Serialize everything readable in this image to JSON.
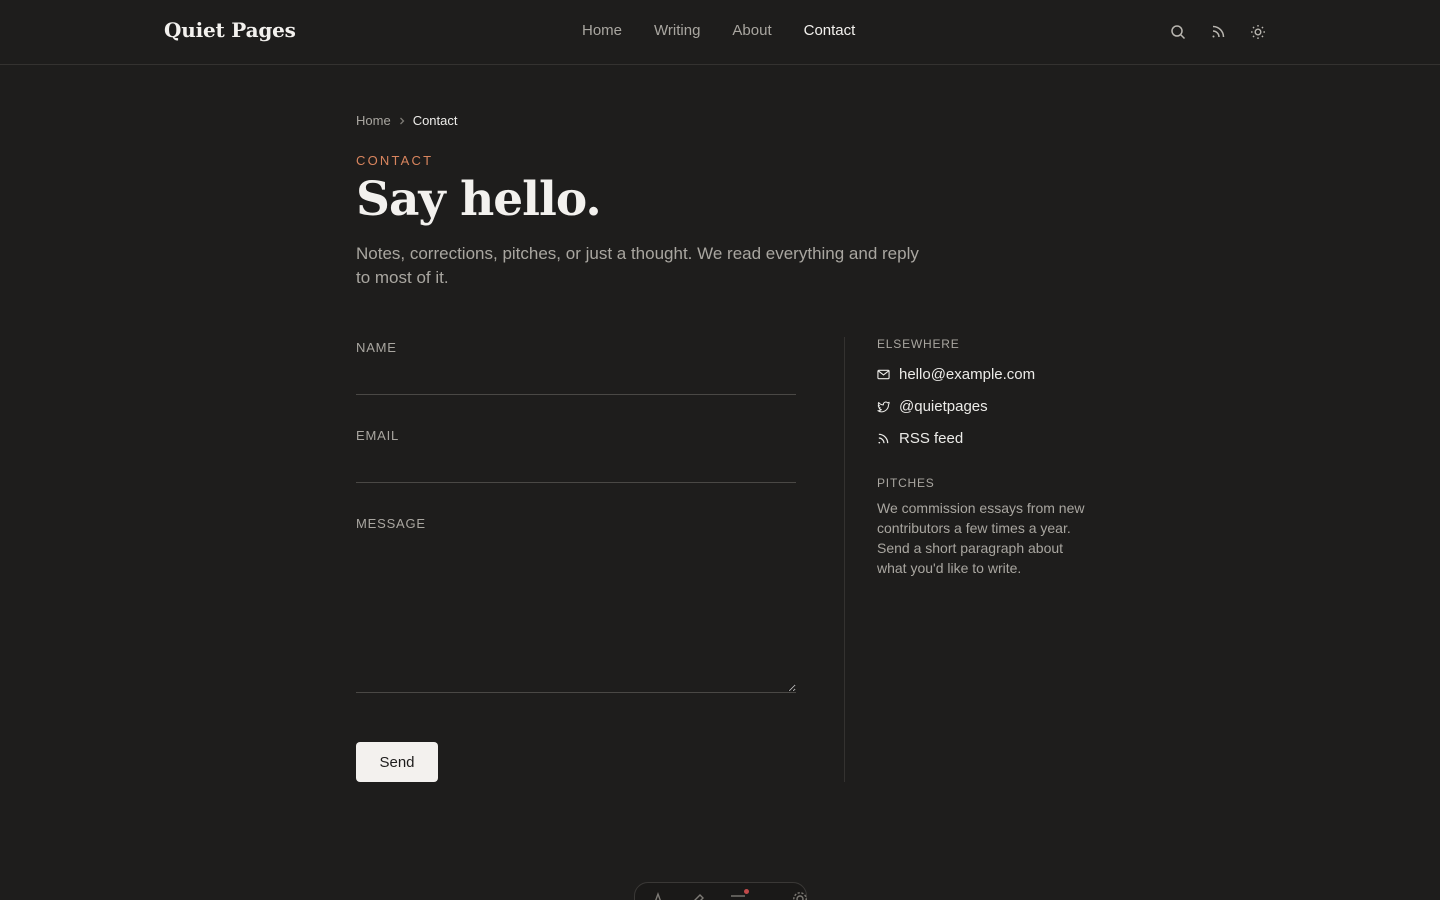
{
  "header": {
    "brand": "Quiet Pages",
    "nav": [
      {
        "label": "Home",
        "active": false
      },
      {
        "label": "Writing",
        "active": false
      },
      {
        "label": "About",
        "active": false
      },
      {
        "label": "Contact",
        "active": true
      }
    ],
    "icons": [
      "search-icon",
      "rss-icon",
      "sun-icon"
    ]
  },
  "breadcrumb": {
    "home": "Home",
    "current": "Contact"
  },
  "hero": {
    "eyebrow": "CONTACT",
    "title": "Say hello.",
    "intro": "Notes, corrections, pitches, or just a thought. We read everything and reply to most of it."
  },
  "form": {
    "name_label": "NAME",
    "name_value": "",
    "email_label": "EMAIL",
    "email_value": "",
    "message_label": "MESSAGE",
    "message_value": "",
    "send_label": "Send"
  },
  "aside": {
    "elsewhere_heading": "ELSEWHERE",
    "links": [
      {
        "icon": "mail-icon",
        "label": "hello@example.com"
      },
      {
        "icon": "twitter-icon",
        "label": "@quietpages"
      },
      {
        "icon": "rss-icon",
        "label": "RSS feed"
      }
    ],
    "pitches_heading": "PITCHES",
    "pitches_text": "We commission essays from new contributors a few times a year. Send a short paragraph about what you'd like to write."
  },
  "colors": {
    "background": "#1e1d1c",
    "accent": "#d9855e",
    "text": "#ecebe8",
    "muted": "#a9a6a0"
  }
}
